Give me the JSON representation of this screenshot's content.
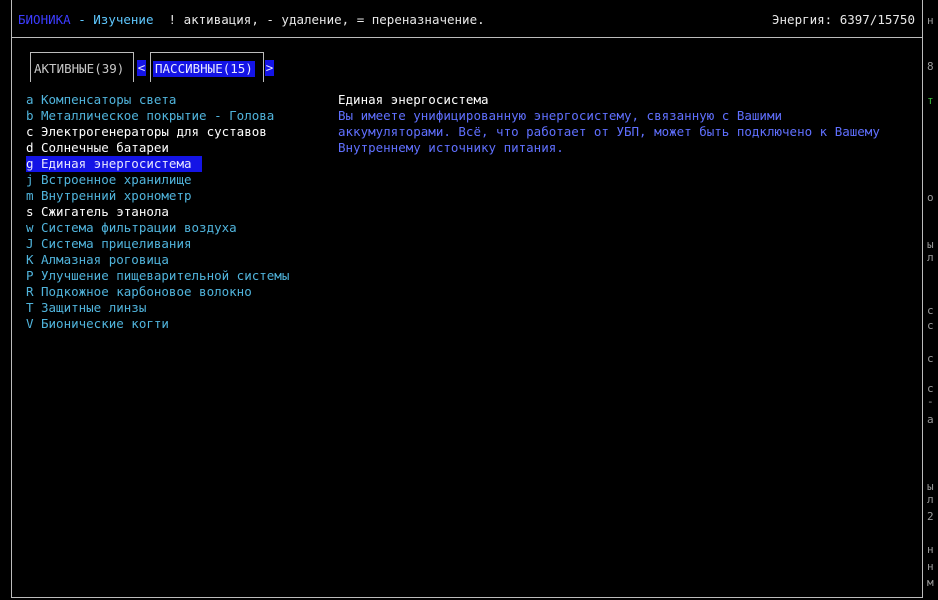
{
  "header": {
    "app": "БИОНИКА",
    "mode": "- Изучение",
    "help": "! активация, - удаление, = переназначение.",
    "energy": "Энергия: 6397/15750"
  },
  "tabs": {
    "active": "АКТИВНЫЕ(39)",
    "passive": "ПАССИВНЫЕ(15)",
    "prev_arrow": "<",
    "next_arrow": ">"
  },
  "items": [
    {
      "key": "a",
      "name": "Компенсаторы света",
      "color": "#50b4dc"
    },
    {
      "key": "b",
      "name": "Металлическое покрытие - Голова",
      "color": "#50b4dc"
    },
    {
      "key": "c",
      "name": "Электрогенераторы для суставов",
      "color": "#ffffff"
    },
    {
      "key": "d",
      "name": "Солнечные батареи",
      "color": "#ffffff"
    },
    {
      "key": "g",
      "name": "Единая энергосистема",
      "color": "#e8e8ff",
      "selected": true
    },
    {
      "key": "j",
      "name": "Встроенное хранилище",
      "color": "#50b4dc"
    },
    {
      "key": "m",
      "name": "Внутренний хронометр",
      "color": "#50b4dc"
    },
    {
      "key": "s",
      "name": "Сжигатель этанола",
      "color": "#ffffff"
    },
    {
      "key": "w",
      "name": "Система фильтрации воздуха",
      "color": "#50b4dc"
    },
    {
      "key": "J",
      "name": "Система прицеливания",
      "color": "#50b4dc"
    },
    {
      "key": "K",
      "name": "Алмазная роговица",
      "color": "#50b4dc"
    },
    {
      "key": "P",
      "name": "Улучшение пищеварительной системы",
      "color": "#50b4dc"
    },
    {
      "key": "R",
      "name": "Подкожное карбоновое волокно",
      "color": "#50b4dc"
    },
    {
      "key": "T",
      "name": "Защитные линзы",
      "color": "#50b4dc"
    },
    {
      "key": "V",
      "name": "Бионические когти",
      "color": "#50b4dc"
    }
  ],
  "detail": {
    "name": "Единая энергосистема",
    "description": "Вы имеете унифицированную энергосистему, связанную с Вашими\nаккумуляторами. Всё, что работает от УБП, может быть подключено к Вашему\nВнутреннему источнику питания."
  },
  "edge_fragments": [
    "н",
    "8",
    "т",
    "о",
    "ы",
    "л",
    "с",
    "с",
    "с",
    "с",
    "-",
    "а",
    "ы",
    "л",
    "2",
    "н",
    "н",
    "м"
  ]
}
